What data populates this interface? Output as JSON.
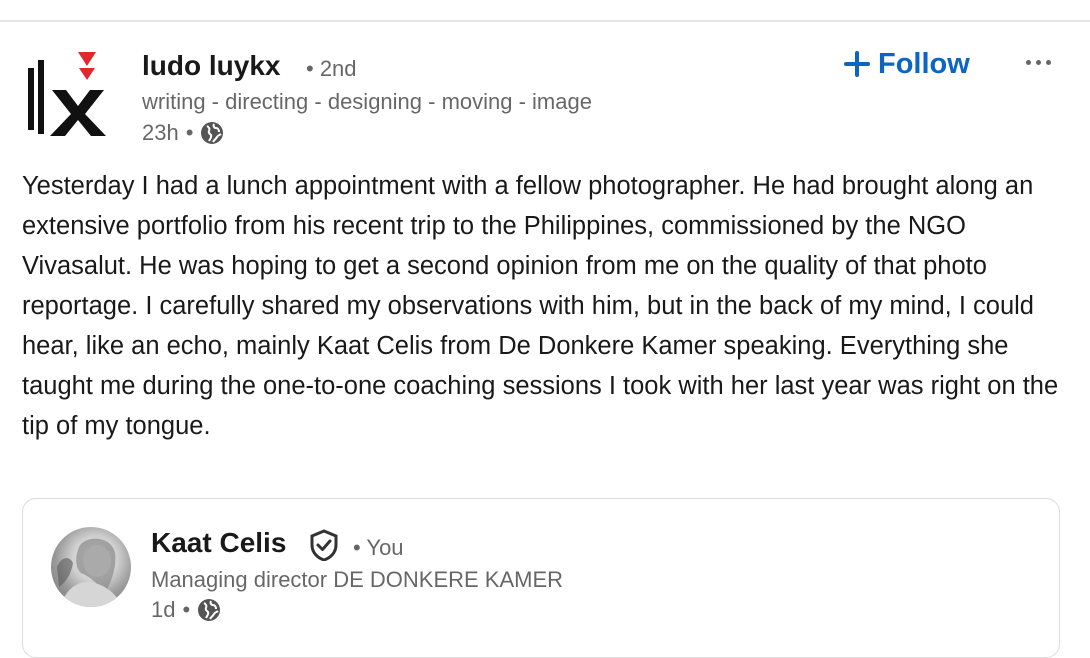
{
  "post": {
    "author": {
      "name": "ludo luykx",
      "degree": "• 2nd",
      "headline": "writing - directing - designing - moving - image",
      "time": "23h",
      "time_separator": "•",
      "visibility_icon": "globe-icon",
      "logo_icon": "lx-logo"
    },
    "follow_label": "Follow",
    "more_icon": "ellipsis-icon",
    "body": "Yesterday I had a lunch appointment with a fellow photographer. He had brought along an extensive portfolio from his recent trip to the Philippines, commissioned by the NGO Vivasalut. He was hoping to get a second opinion from me on the quality of that photo reportage. I carefully shared my observations with him, but in the back of my mind, I could hear, like an echo, mainly Kaat Celis from De Donkere Kamer speaking. Everything she taught me during the one-to-one coaching sessions I took with her last year was right on the tip of my tongue."
  },
  "shared": {
    "name": "Kaat Celis",
    "relation": "• You",
    "headline": "Managing director DE DONKERE KAMER",
    "time": "1d",
    "time_separator": "•",
    "verified_icon": "verified-shield-icon",
    "visibility_icon": "globe-icon"
  },
  "colors": {
    "accent": "#0a66c2",
    "logo_red": "#e0282e",
    "text_primary": "#191919",
    "text_secondary": "#666666"
  }
}
